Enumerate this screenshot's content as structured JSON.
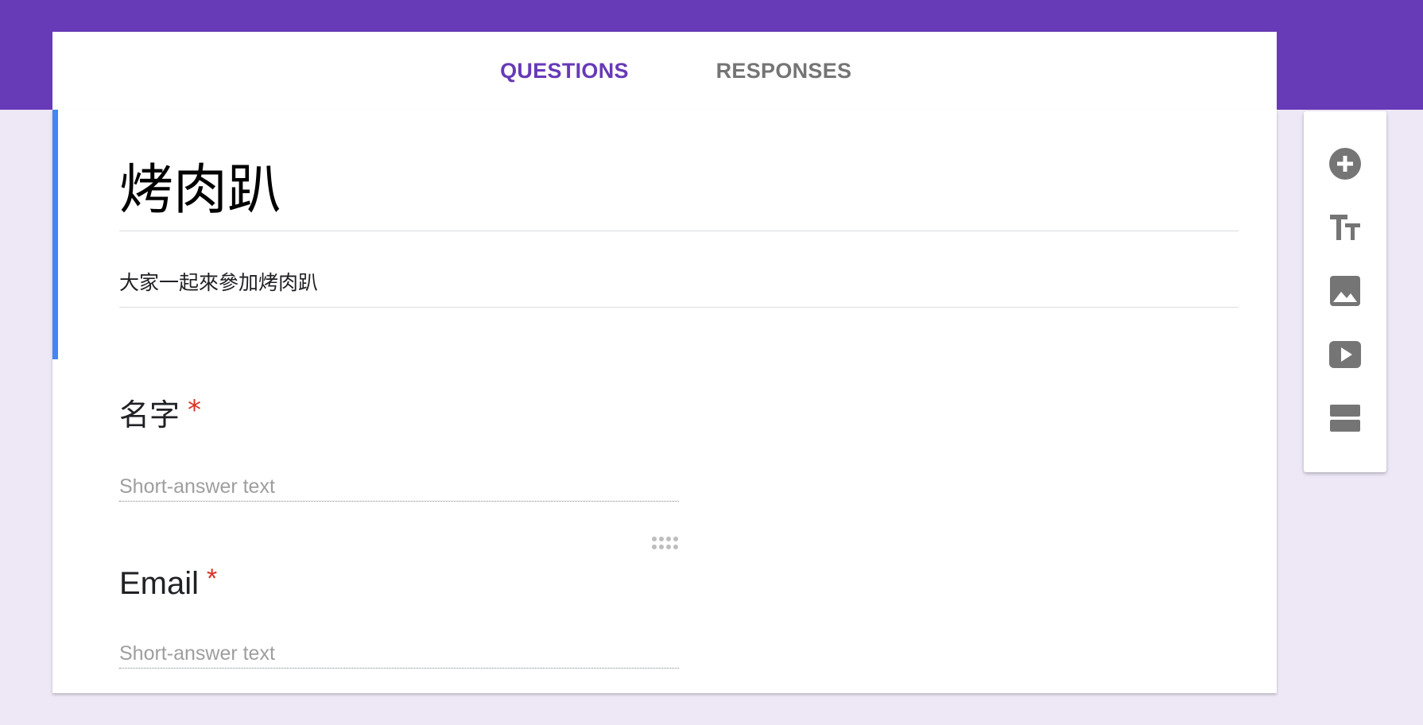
{
  "tabs": {
    "questions": "QUESTIONS",
    "responses": "RESPONSES",
    "active": "questions"
  },
  "form": {
    "title": "烤肉趴",
    "description": "大家一起來參加烤肉趴"
  },
  "questions": [
    {
      "label": "名字",
      "required_mark": "*",
      "placeholder": "Short-answer text"
    },
    {
      "label": "Email",
      "required_mark": "*",
      "placeholder": "Short-answer text"
    }
  ],
  "toolbar": {
    "icons": [
      "add-question-icon",
      "add-title-icon",
      "add-image-icon",
      "add-video-icon",
      "add-section-icon"
    ]
  },
  "colors": {
    "theme": "#673ab7",
    "background": "#ede7f6",
    "focus_bar": "#4285f4",
    "required": "#d93025",
    "icon": "#757575"
  }
}
